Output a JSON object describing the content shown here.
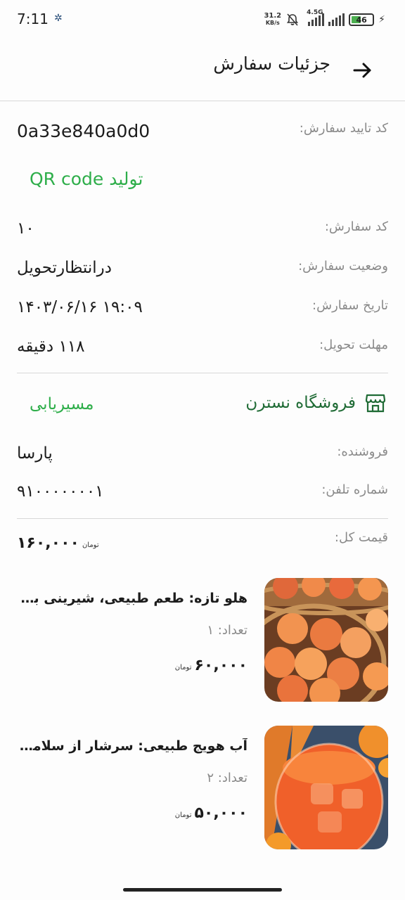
{
  "status_bar": {
    "time": "7:11",
    "net_speed": "31.2",
    "net_speed_unit": "KB/s",
    "network": "4.5G",
    "battery": "46"
  },
  "app_bar": {
    "title": "جزئیات سفارش"
  },
  "order": {
    "confirm_code_label": "کد تایید سفارش:",
    "confirm_code": "0a33e840a0d0",
    "qr_link": "تولید QR code",
    "order_code_label": "کد سفارش:",
    "order_code": "۱۰",
    "status_label": "وضعیت سفارش:",
    "status": "درانتظارتحویل",
    "date_label": "تاریخ سفارش:",
    "date": "۱۴۰۳/۰۶/۱۶ ۱۹:۰۹",
    "deadline_label": "مهلت تحویل:",
    "deadline": "۱۱۸ دقیقه"
  },
  "store": {
    "name": "فروشگاه نسترن",
    "route_link": "مسیریابی",
    "seller_label": "فروشنده:",
    "seller": "پارسا",
    "phone_label": "شماره تلفن:",
    "phone": "۹۱۰۰۰۰۰۰۰۱",
    "total_label": "قیمت کل:",
    "total": "۱۶۰,۰۰۰",
    "currency": "تومان"
  },
  "products": [
    {
      "title": "هلو تازه: طعم طبیعی، شیرینی بی‌نظیر",
      "qty": "تعداد: ۱",
      "price": "۶۰,۰۰۰",
      "currency": "تومان",
      "image_icon": "peach-photo"
    },
    {
      "title": "آب هویج طبیعی: سرشار از سلامتی و انرژی",
      "qty": "تعداد: ۲",
      "price": "۵۰,۰۰۰",
      "currency": "تومان",
      "image_icon": "carrot-juice-photo"
    }
  ],
  "colors": {
    "accent_green": "#2eae4a",
    "store_green": "#1f6b35",
    "label_gray": "#8a8a8a"
  }
}
